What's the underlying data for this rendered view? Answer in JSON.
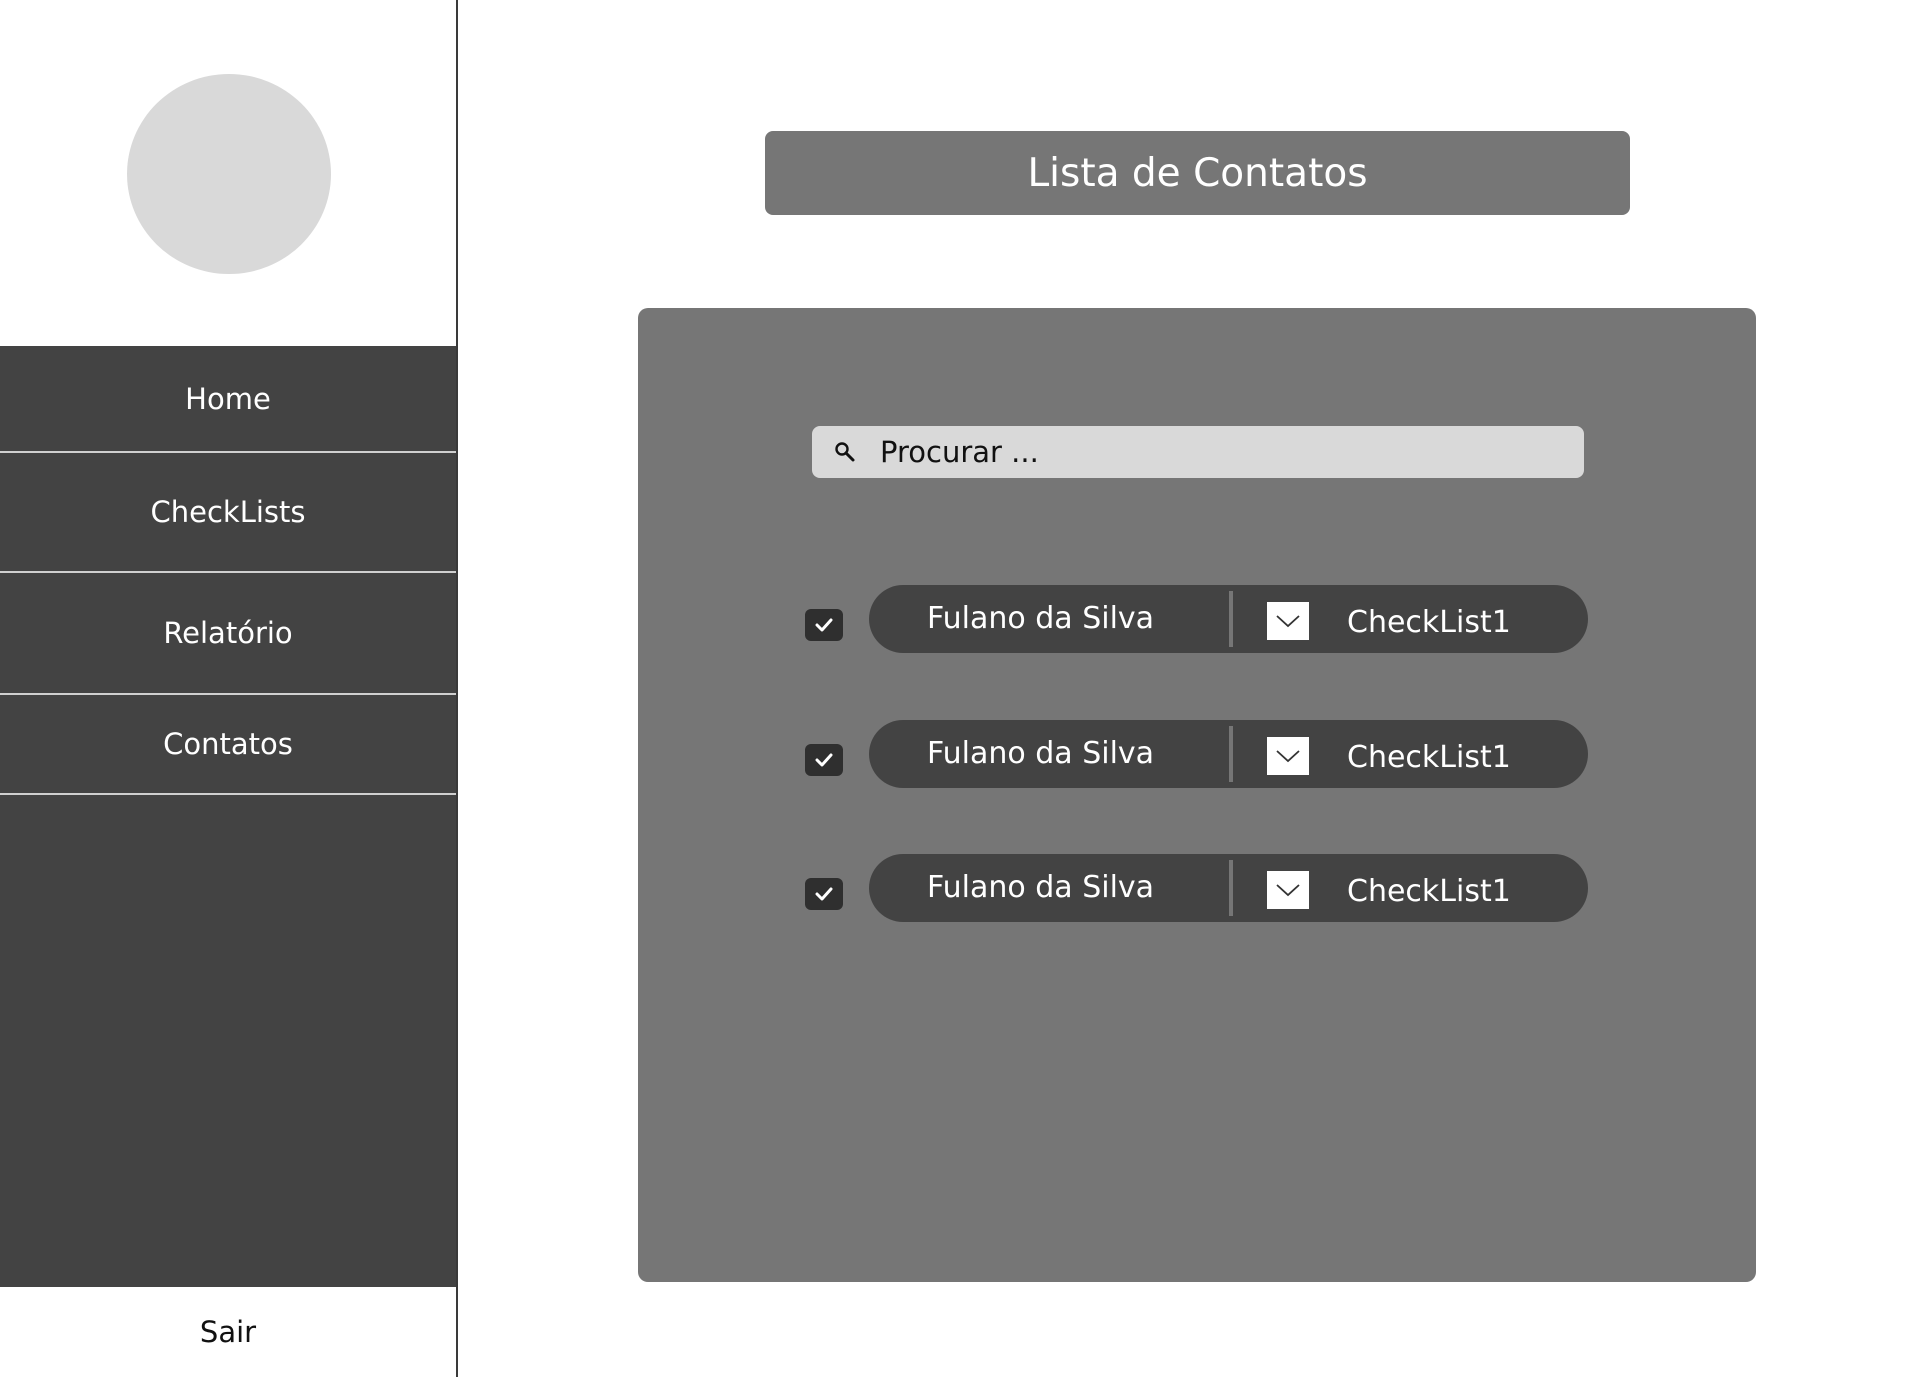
{
  "sidebar": {
    "nav": [
      {
        "label": "Home"
      },
      {
        "label": "CheckLists"
      },
      {
        "label": "Relatório"
      },
      {
        "label": "Contatos"
      }
    ],
    "logout_label": "Sair"
  },
  "header": {
    "title": "Lista de Contatos"
  },
  "search": {
    "placeholder": "Procurar ...",
    "icon": "search-icon"
  },
  "contacts": [
    {
      "checked": true,
      "name": "Fulano da Silva",
      "checklist": "CheckList1"
    },
    {
      "checked": true,
      "name": "Fulano da Silva",
      "checklist": "CheckList1"
    },
    {
      "checked": true,
      "name": "Fulano da Silva",
      "checklist": "CheckList1"
    }
  ],
  "colors": {
    "sidebar_bg": "#434343",
    "panel_bg": "#767676",
    "avatar": "#d9d9d9",
    "pill_bg": "#434343",
    "checkbox_bg": "#2f2f2f"
  }
}
